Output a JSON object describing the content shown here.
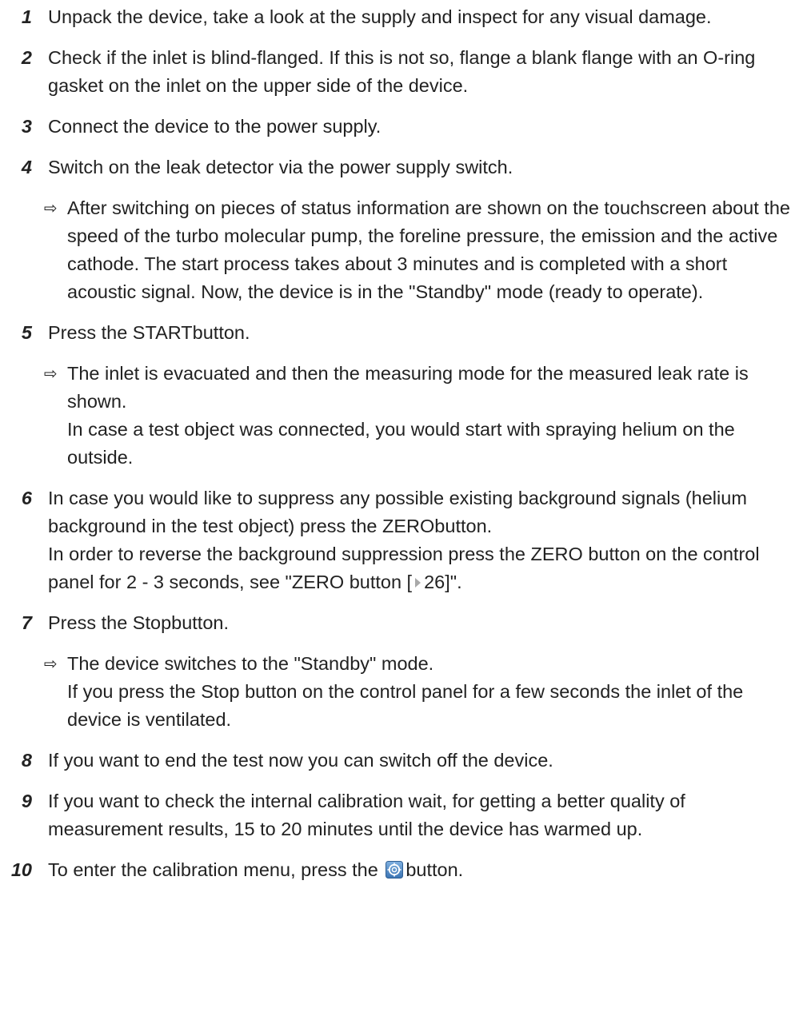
{
  "steps": [
    {
      "num": "1",
      "text": "Unpack the device, take a look at the supply and inspect for any visual damage."
    },
    {
      "num": "2",
      "text": "Check if the inlet is blind-flanged. If this is not so, flange a blank flange with an O-ring gasket on the inlet on the upper side of the device."
    },
    {
      "num": "3",
      "text": "Connect the device to the power supply."
    },
    {
      "num": "4",
      "text": "Switch on the leak detector via the power supply switch."
    },
    {
      "num": "5",
      "text": "Press the STARTbutton."
    },
    {
      "num": "6",
      "text_a": "In case you would like to suppress any possible existing background signals (helium background in the test object) press the ZERObutton.",
      "text_b_pre": "In order to reverse the background suppression press the ZERO button on the control panel for 2 - 3 seconds, see \"ZERO button [",
      "xref_page": "26",
      "text_b_post": "]\"."
    },
    {
      "num": "7",
      "text": "Press the Stopbutton."
    },
    {
      "num": "8",
      "text": "If you want to end the test now you can switch off the device."
    },
    {
      "num": "9",
      "text": "If you want to check the internal calibration wait, for getting a better quality of measurement results, 15 to 20 minutes until the device has warmed up."
    },
    {
      "num": "10",
      "text_pre": "To enter the calibration menu, press the",
      "text_post": "button.",
      "icon": "calibration-target-icon"
    }
  ],
  "results": {
    "r4": {
      "arrow": "⇨",
      "text": "After switching on pieces of status information are shown on the touchscreen about the speed of the turbo molecular pump, the foreline pressure, the emission and the active cathode. The start process takes about 3 minutes and is completed with a short acoustic signal. Now, the device is in the \"Standby\" mode (ready to operate)."
    },
    "r5": {
      "arrow": "⇨",
      "text_a": "The inlet is evacuated and then the measuring mode for the measured leak rate is shown.",
      "text_b": "In case a test object was connected, you would start with spraying helium on the outside."
    },
    "r7": {
      "arrow": "⇨",
      "text_a": "The device switches to the \"Standby\" mode.",
      "text_b": "If you press the Stop button on the control panel for a few seconds the inlet of the device is ventilated."
    }
  },
  "colors": {
    "text": "#222222",
    "xref_arrow": "#a9a9a9",
    "icon_blue": "#4a86c5"
  }
}
